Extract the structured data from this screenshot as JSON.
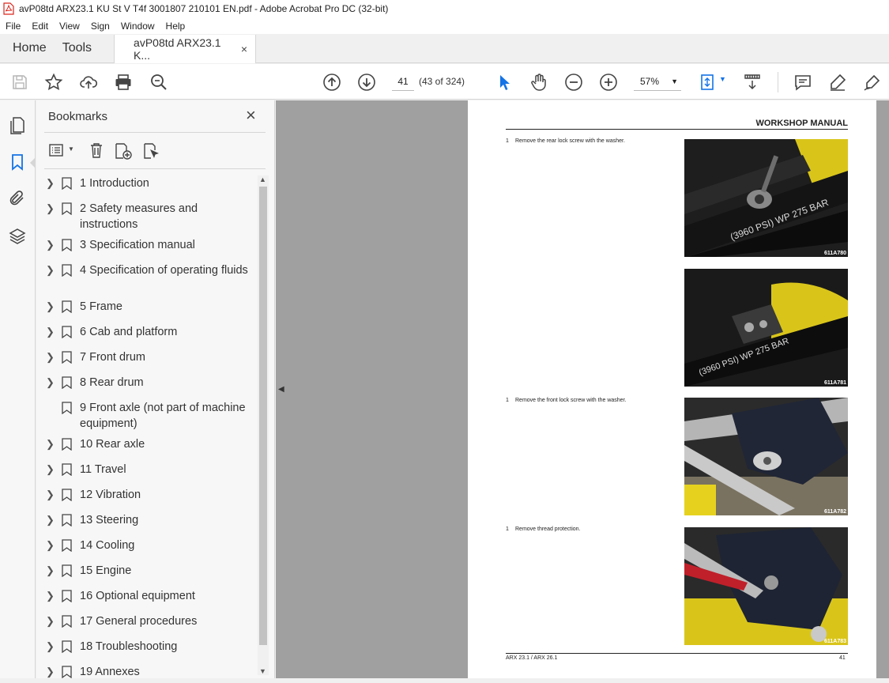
{
  "window": {
    "title": "avP08td ARX23.1 KU St V T4f 3001807 210101 EN.pdf - Adobe Acrobat Pro DC (32-bit)"
  },
  "menu": [
    "File",
    "Edit",
    "View",
    "Sign",
    "Window",
    "Help"
  ],
  "tabs": {
    "home": "Home",
    "tools": "Tools",
    "doc": "avP08td ARX23.1 K...",
    "close": "×"
  },
  "toolbar": {
    "page_input": "41",
    "page_count": "(43 of 324)",
    "zoom": "57%"
  },
  "panel": {
    "title": "Bookmarks",
    "close": "×",
    "bookmarks": [
      {
        "label": "1 Introduction",
        "expandable": true
      },
      {
        "label": "2 Safety measures and instructions",
        "expandable": true
      },
      {
        "label": "3 Specification manual",
        "expandable": true
      },
      {
        "label": "4 Specification of operating fluids",
        "expandable": true
      },
      {
        "label": "5 Frame",
        "expandable": true
      },
      {
        "label": "6 Cab and platform",
        "expandable": true
      },
      {
        "label": "7 Front drum",
        "expandable": true
      },
      {
        "label": "8 Rear drum",
        "expandable": true
      },
      {
        "label": "9 Front axle (not part of machine equipment)",
        "expandable": false
      },
      {
        "label": "10 Rear axle",
        "expandable": true
      },
      {
        "label": "11 Travel",
        "expandable": true
      },
      {
        "label": "12 Vibration",
        "expandable": true
      },
      {
        "label": "13 Steering",
        "expandable": true
      },
      {
        "label": "14 Cooling",
        "expandable": true
      },
      {
        "label": "15 Engine",
        "expandable": true
      },
      {
        "label": "16 Optional equipment",
        "expandable": true
      },
      {
        "label": "17 General procedures",
        "expandable": true
      },
      {
        "label": "18 Troubleshooting",
        "expandable": true
      },
      {
        "label": "19 Annexes",
        "expandable": true
      }
    ]
  },
  "document": {
    "header": "WORKSHOP MANUAL",
    "steps": [
      {
        "num": "1",
        "text": "Remove the rear lock screw with the washer."
      },
      {
        "num": "1",
        "text": "Remove the front lock screw with the washer."
      },
      {
        "num": "1",
        "text": "Remove thread protection."
      }
    ],
    "photos": [
      "611A780",
      "611A781",
      "611A782",
      "611A783"
    ],
    "footer_left": "ARX 23.1 / ARX 26.1",
    "footer_right": "41"
  },
  "colors": {
    "accent": "#1473e6",
    "viewer_bg": "#a0a0a0",
    "machine_yellow": "#e6d21e"
  }
}
